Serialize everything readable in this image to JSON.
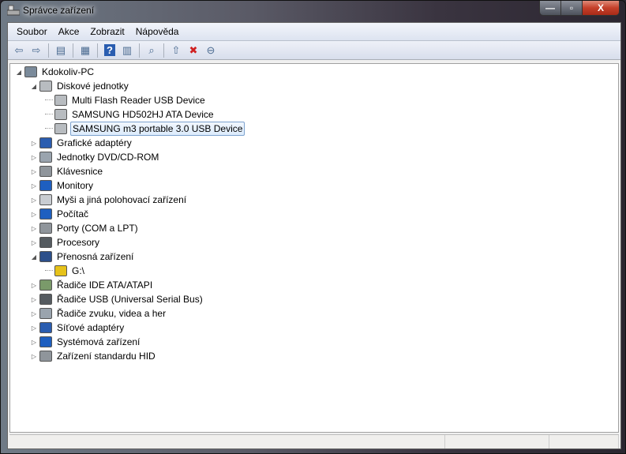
{
  "window": {
    "title": "Správce zařízení",
    "minimize": "—",
    "maximize": "▫",
    "close": "X"
  },
  "menu": [
    "Soubor",
    "Akce",
    "Zobrazit",
    "Nápověda"
  ],
  "toolbar": [
    {
      "icon": "back-icon",
      "glyph": "⇦"
    },
    {
      "icon": "forward-icon",
      "glyph": "⇨"
    },
    {
      "icon": "show-hide-console-tree-icon",
      "glyph": "▤"
    },
    {
      "icon": "properties-icon",
      "glyph": "▦"
    },
    {
      "icon": "help-icon",
      "glyph": "?"
    },
    {
      "icon": "show-action-pane-icon",
      "glyph": "▥"
    },
    {
      "icon": "scan-hardware-icon",
      "glyph": "⌕"
    },
    {
      "icon": "update-driver-icon",
      "glyph": "⇧"
    },
    {
      "icon": "uninstall-icon",
      "glyph": "✖"
    },
    {
      "icon": "disable-icon",
      "glyph": "⊖"
    }
  ],
  "tree": [
    {
      "label": "Kdokoliv-PC",
      "level": 0,
      "expander": "expanded",
      "icon": "computer-icon",
      "color": "#7a8a9a"
    },
    {
      "label": "Diskové jednotky",
      "level": 1,
      "expander": "expanded",
      "icon": "disk-drive-icon",
      "color": "#b8bcc0"
    },
    {
      "label": "Multi Flash Reader USB Device",
      "level": 2,
      "expander": "none",
      "icon": "disk-drive-icon",
      "color": "#b8bcc0"
    },
    {
      "label": "SAMSUNG HD502HJ ATA Device",
      "level": 2,
      "expander": "none",
      "icon": "disk-drive-icon",
      "color": "#b8bcc0"
    },
    {
      "label": "SAMSUNG m3 portable 3.0 USB Device",
      "level": 2,
      "expander": "none",
      "icon": "disk-drive-icon",
      "color": "#b8bcc0",
      "selected": true
    },
    {
      "label": "Grafické adaptéry",
      "level": 1,
      "expander": "collapsed",
      "icon": "display-adapter-icon",
      "color": "#2a5db0"
    },
    {
      "label": "Jednotky DVD/CD-ROM",
      "level": 1,
      "expander": "collapsed",
      "icon": "dvd-drive-icon",
      "color": "#9aa4ae"
    },
    {
      "label": "Klávesnice",
      "level": 1,
      "expander": "collapsed",
      "icon": "keyboard-icon",
      "color": "#8f959b"
    },
    {
      "label": "Monitory",
      "level": 1,
      "expander": "collapsed",
      "icon": "monitor-icon",
      "color": "#1e5fc0"
    },
    {
      "label": "Myši a jiná polohovací zařízení",
      "level": 1,
      "expander": "collapsed",
      "icon": "mouse-icon",
      "color": "#c9cdd2"
    },
    {
      "label": "Počítač",
      "level": 1,
      "expander": "collapsed",
      "icon": "computer-icon",
      "color": "#1e5fc0"
    },
    {
      "label": "Porty (COM a LPT)",
      "level": 1,
      "expander": "collapsed",
      "icon": "port-icon",
      "color": "#8f959b"
    },
    {
      "label": "Procesory",
      "level": 1,
      "expander": "collapsed",
      "icon": "processor-icon",
      "color": "#555b60"
    },
    {
      "label": "Přenosná zařízení",
      "level": 1,
      "expander": "expanded",
      "icon": "portable-device-icon",
      "color": "#2c4f8a"
    },
    {
      "label": "G:\\",
      "level": 2,
      "expander": "none",
      "icon": "portable-device-warning-icon",
      "color": "#e6c21a"
    },
    {
      "label": "Řadiče IDE ATA/ATAPI",
      "level": 1,
      "expander": "collapsed",
      "icon": "ide-controller-icon",
      "color": "#7a9a6a"
    },
    {
      "label": "Řadiče USB (Universal Serial Bus)",
      "level": 1,
      "expander": "collapsed",
      "icon": "usb-icon",
      "color": "#555b60"
    },
    {
      "label": "Řadiče zvuku, videa a her",
      "level": 1,
      "expander": "collapsed",
      "icon": "sound-icon",
      "color": "#9aa4ae"
    },
    {
      "label": "Síťové adaptéry",
      "level": 1,
      "expander": "collapsed",
      "icon": "network-adapter-icon",
      "color": "#2a5db0"
    },
    {
      "label": "Systémová zařízení",
      "level": 1,
      "expander": "collapsed",
      "icon": "system-device-icon",
      "color": "#1e5fc0"
    },
    {
      "label": "Zařízení standardu HID",
      "level": 1,
      "expander": "collapsed",
      "icon": "hid-icon",
      "color": "#8f959b"
    }
  ]
}
